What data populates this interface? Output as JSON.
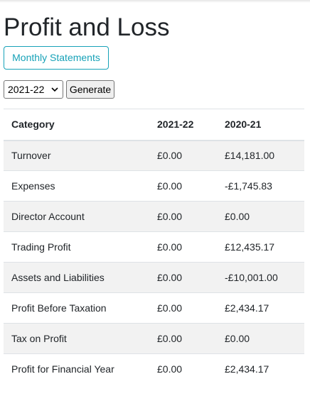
{
  "page": {
    "title": "Profit and Loss",
    "monthly_button": "Monthly Statements"
  },
  "controls": {
    "year_select_value": "2021-22",
    "generate_label": "Generate"
  },
  "table": {
    "headers": [
      "Category",
      "2021-22",
      "2020-21"
    ],
    "rows": [
      [
        "Turnover",
        "£0.00",
        "£14,181.00"
      ],
      [
        "Expenses",
        "£0.00",
        "-£1,745.83"
      ],
      [
        "Director Account",
        "£0.00",
        "£0.00"
      ],
      [
        "Trading Profit",
        "£0.00",
        "£12,435.17"
      ],
      [
        "Assets and Liabilities",
        "£0.00",
        "-£10,001.00"
      ],
      [
        "Profit Before Taxation",
        "£0.00",
        "£2,434.17"
      ],
      [
        "Tax on Profit",
        "£0.00",
        "£0.00"
      ],
      [
        "Profit for Financial Year",
        "£0.00",
        "£2,434.17"
      ]
    ]
  },
  "colors": {
    "accent": "#17a2b8",
    "stripe": "#f2f2f2",
    "border": "#dee2e6"
  }
}
